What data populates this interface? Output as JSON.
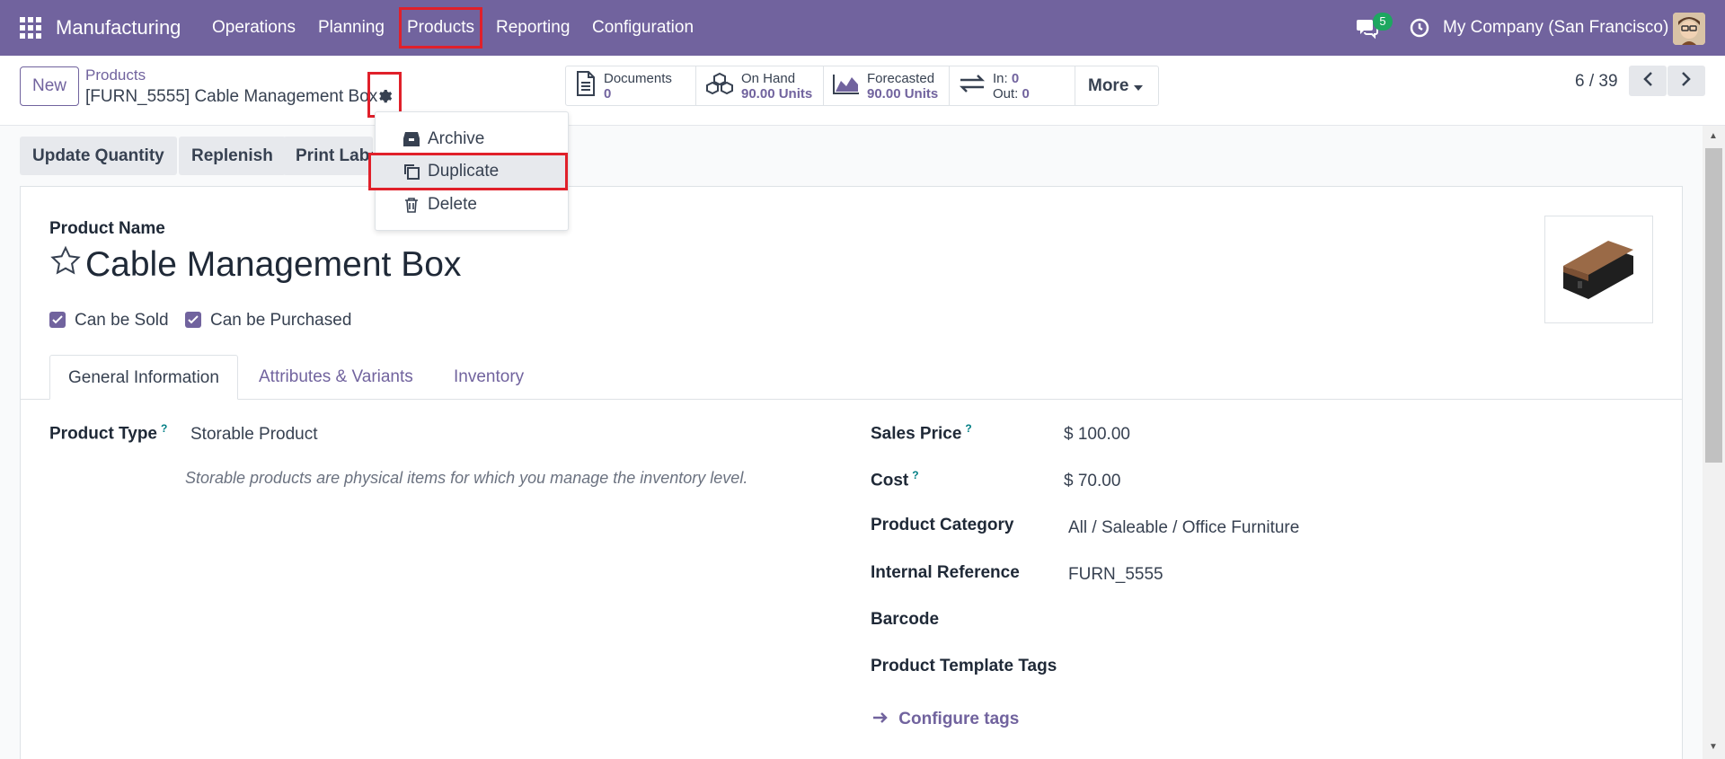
{
  "navbar": {
    "brand": "Manufacturing",
    "menu": [
      "Operations",
      "Planning",
      "Products",
      "Reporting",
      "Configuration"
    ],
    "chat_count": "5",
    "company": "My Company (San Francisco)"
  },
  "control_panel": {
    "new_label": "New",
    "breadcrumb_parent": "Products",
    "breadcrumb_current": "[FURN_5555] Cable Management Box",
    "smart_buttons": {
      "documents": {
        "label": "Documents",
        "value": "0"
      },
      "on_hand": {
        "label": "On Hand",
        "value": "90.00 Units"
      },
      "forecasted": {
        "label": "Forecasted",
        "value": "90.00 Units"
      },
      "in_label": "In:",
      "in_value": "0",
      "out_label": "Out:",
      "out_value": "0",
      "more": "More"
    },
    "pager": "6 / 39"
  },
  "actions": {
    "update_quantity": "Update Quantity",
    "replenish": "Replenish",
    "print_labels": "Print Labe"
  },
  "dropdown": {
    "archive": "Archive",
    "duplicate": "Duplicate",
    "delete": "Delete"
  },
  "form": {
    "product_name_label": "Product Name",
    "product_name": "Cable Management Box",
    "can_be_sold": "Can be Sold",
    "can_be_purchased": "Can be Purchased",
    "tabs": [
      "General Information",
      "Attributes & Variants",
      "Inventory"
    ],
    "product_type_label": "Product Type",
    "product_type_value": "Storable Product",
    "product_type_help": "Storable products are physical items for which you manage the inventory level.",
    "sales_price_label": "Sales Price",
    "sales_price_value": "$ 100.00",
    "cost_label": "Cost",
    "cost_value": "$ 70.00",
    "category_label": "Product Category",
    "category_value": "All / Saleable / Office Furniture",
    "internal_ref_label": "Internal Reference",
    "internal_ref_value": "FURN_5555",
    "barcode_label": "Barcode",
    "tags_label": "Product Template Tags",
    "configure_tags": "Configure tags",
    "help_mark": "?"
  },
  "colors": {
    "brand": "#71639e",
    "highlight": "#e0202a",
    "badge": "#1da760"
  }
}
